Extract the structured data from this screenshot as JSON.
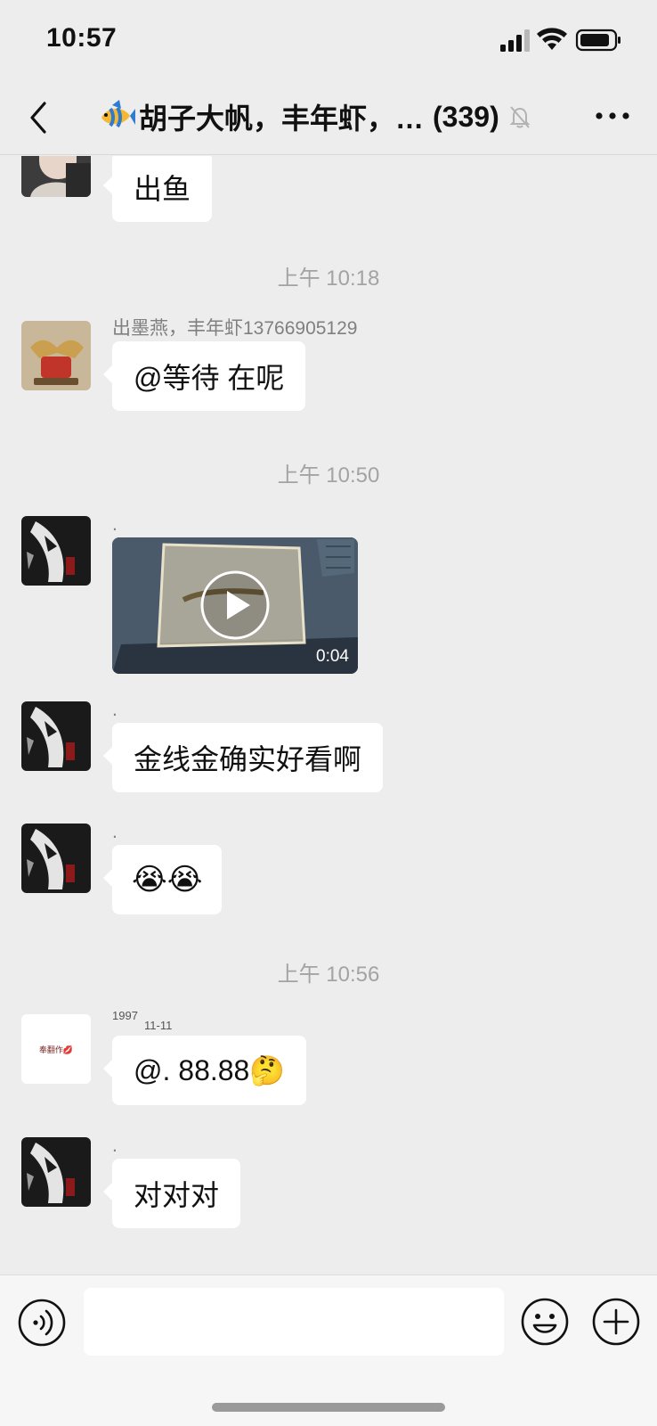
{
  "status_bar": {
    "time": "10:57"
  },
  "header": {
    "title": "胡子大帆，丰年虾，…",
    "member_count": "(339)"
  },
  "messages": [
    {
      "type": "text",
      "sender": "",
      "text": "出鱼"
    },
    {
      "type": "time",
      "text": "上午 10:18"
    },
    {
      "type": "text",
      "sender": "出墨燕，丰年虾13766905129",
      "text": "@等待 在呢"
    },
    {
      "type": "time",
      "text": "上午 10:50"
    },
    {
      "type": "video",
      "sender": ".",
      "duration": "0:04"
    },
    {
      "type": "text",
      "sender": ".",
      "text": "金线金确实好看啊"
    },
    {
      "type": "emoji",
      "sender": ".",
      "text": "😭😭"
    },
    {
      "type": "time",
      "text": "上午 10:56"
    },
    {
      "type": "text",
      "sender_line1": "1997",
      "sender_line2": "11-11",
      "text": "@. 88.88🤔",
      "avatar_text": "奉翻作💋"
    },
    {
      "type": "text",
      "sender": ".",
      "text": "对对对"
    }
  ],
  "input_bar": {
    "placeholder": ""
  },
  "icons": {
    "back": "chevron-left-icon",
    "mute": "bell-slash-icon",
    "more": "more-dots-icon",
    "voice": "voice-icon",
    "emoji": "emoji-icon",
    "plus": "plus-icon"
  }
}
